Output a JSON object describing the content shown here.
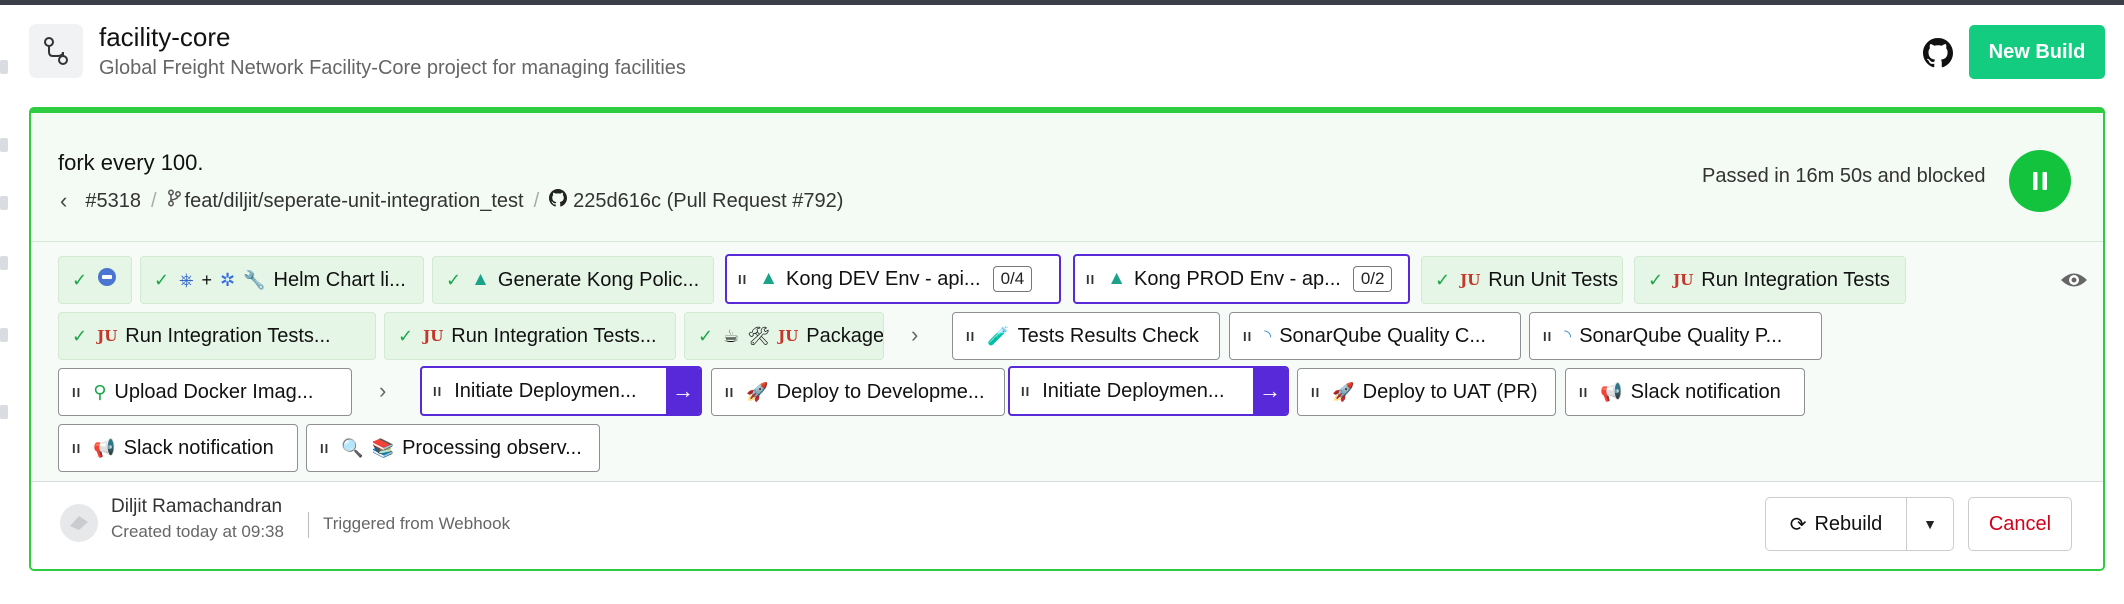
{
  "project": {
    "name": "facility-core",
    "description": "Global Freight Network Facility-Core project for managing facilities",
    "icon": "pipeline-icon",
    "new_build_label": "New Build"
  },
  "build": {
    "message": "fork every 100.",
    "number": "#5318",
    "branch": "feat/diljit/seperate-unit-integration_test",
    "commit": "225d616c (Pull Request #792)",
    "status_text": "Passed in 16m 50s and blocked",
    "status_color": "#13c23d"
  },
  "jobs": [
    {
      "state": "passed",
      "icons": [
        "circle-badge-icon"
      ],
      "label": ""
    },
    {
      "state": "passed",
      "icons": [
        "helm-icon",
        "plus",
        "kubernetes-icon",
        "wrench-icon"
      ],
      "label": "Helm Chart li..."
    },
    {
      "state": "passed",
      "icons": [
        "kong-icon"
      ],
      "label": "Generate Kong Polic..."
    },
    {
      "state": "blocked-group",
      "icons": [
        "kong-icon"
      ],
      "label": "Kong DEV Env - api...",
      "count": "0/4"
    },
    {
      "state": "blocked-group",
      "icons": [
        "kong-icon"
      ],
      "label": "Kong PROD Env - ap...",
      "count": "0/2"
    },
    {
      "state": "passed",
      "icons": [
        "junit-icon"
      ],
      "label": "Run Unit Tests"
    },
    {
      "state": "passed",
      "icons": [
        "junit-icon"
      ],
      "label": "Run Integration Tests"
    },
    {
      "state": "passed",
      "icons": [
        "junit-icon"
      ],
      "label": "Run Integration Tests..."
    },
    {
      "state": "passed",
      "icons": [
        "junit-icon"
      ],
      "label": "Run Integration Tests..."
    },
    {
      "state": "passed",
      "icons": [
        "java-icon",
        "tools-icon",
        "junit-icon"
      ],
      "label": "Package"
    },
    {
      "state": "blocked",
      "icons": [
        "test-tube-icon"
      ],
      "label": "Tests Results Check"
    },
    {
      "state": "blocked",
      "icons": [
        "sonarqube-icon"
      ],
      "label": "SonarQube Quality C..."
    },
    {
      "state": "blocked",
      "icons": [
        "sonarqube-icon"
      ],
      "label": "SonarQube Quality P..."
    },
    {
      "state": "blocked",
      "icons": [
        "docker-icon"
      ],
      "label": "Upload Docker Imag..."
    },
    {
      "state": "trigger",
      "icons": [],
      "label": "Initiate Deploymen..."
    },
    {
      "state": "blocked",
      "icons": [
        "rocket-icon"
      ],
      "label": "Deploy to Developme..."
    },
    {
      "state": "trigger",
      "icons": [],
      "label": "Initiate Deploymen..."
    },
    {
      "state": "blocked",
      "icons": [
        "rocket-icon"
      ],
      "label": "Deploy to UAT (PR)"
    },
    {
      "state": "blocked",
      "icons": [
        "megaphone-icon"
      ],
      "label": "Slack notification"
    },
    {
      "state": "blocked",
      "icons": [
        "megaphone-icon"
      ],
      "label": "Slack notification"
    },
    {
      "state": "blocked",
      "icons": [
        "magnifier-icon",
        "books-icon"
      ],
      "label": "Processing observ..."
    }
  ],
  "footer": {
    "author": "Diljit Ramachandran",
    "created": "Created today at 09:38",
    "trigger": "Triggered from Webhook",
    "rebuild_label": "Rebuild",
    "cancel_label": "Cancel"
  },
  "colors": {
    "accent_green": "#14cc80",
    "passed_border": "#2ecc40",
    "trigger_purple": "#5729d8",
    "cancel_red": "#d0021b"
  }
}
